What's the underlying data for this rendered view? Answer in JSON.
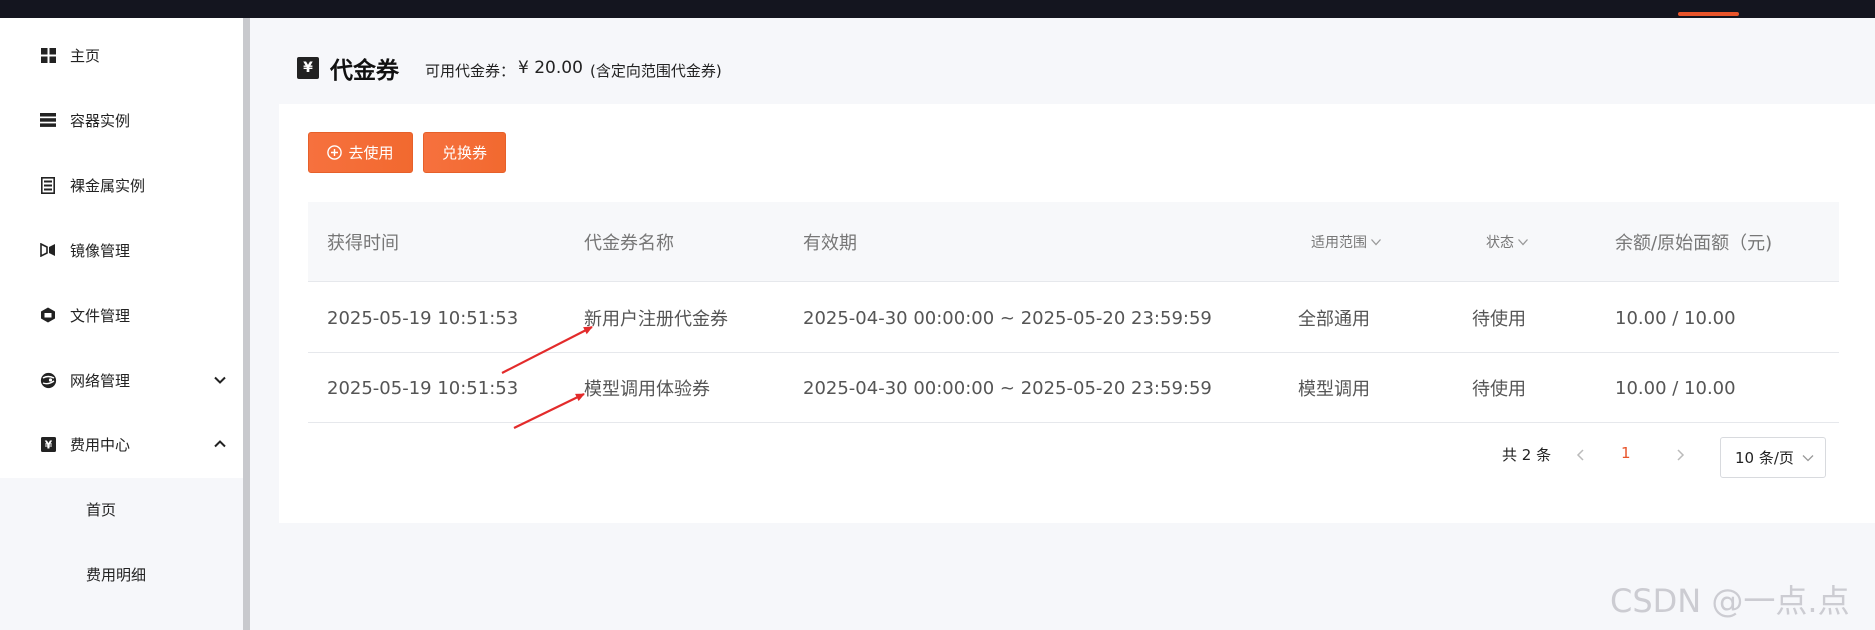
{
  "colors": {
    "accent": "#e8542a",
    "button": "#f6713e",
    "sidebar_divider": "#c8c9cd"
  },
  "sidebar": {
    "items": [
      {
        "label": "主页",
        "icon": "grid-icon"
      },
      {
        "label": "容器实例",
        "icon": "server-stack-icon"
      },
      {
        "label": "裸金属实例",
        "icon": "server-box-icon"
      },
      {
        "label": "镜像管理",
        "icon": "image-bow-icon"
      },
      {
        "label": "文件管理",
        "icon": "hexagon-folder-icon"
      },
      {
        "label": "网络管理",
        "icon": "globe-icon",
        "expand": "chevron-down-icon"
      },
      {
        "label": "费用中心",
        "icon": "yen-icon",
        "expand": "chevron-up-icon"
      }
    ],
    "sub_items": [
      {
        "label": "首页"
      },
      {
        "label": "费用明细"
      }
    ]
  },
  "header": {
    "title": "代金券",
    "title_icon": "¥",
    "available_label": "可用代金券：",
    "available_value": "¥ 20.00",
    "available_note": "(含定向范围代金券)"
  },
  "actions": {
    "use_label": "去使用",
    "redeem_label": "兑换券"
  },
  "table": {
    "columns": [
      "获得时间",
      "代金券名称",
      "有效期",
      "适用范围",
      "状态",
      "余额/原始面额（元)"
    ],
    "rows": [
      {
        "time": "2025-05-19 10:51:53",
        "name": "新用户注册代金券",
        "validity": "2025-04-30 00:00:00 ~ 2025-05-20 23:59:59",
        "scope": "全部通用",
        "status": "待使用",
        "amount": "10.00 / 10.00"
      },
      {
        "time": "2025-05-19 10:51:53",
        "name": "模型调用体验券",
        "validity": "2025-04-30 00:00:00 ~ 2025-05-20 23:59:59",
        "scope": "模型调用",
        "status": "待使用",
        "amount": "10.00 / 10.00"
      }
    ]
  },
  "pagination": {
    "total": "共 2 条",
    "current": "1",
    "page_size": "10 条/页"
  },
  "watermark": "CSDN @一点.点"
}
